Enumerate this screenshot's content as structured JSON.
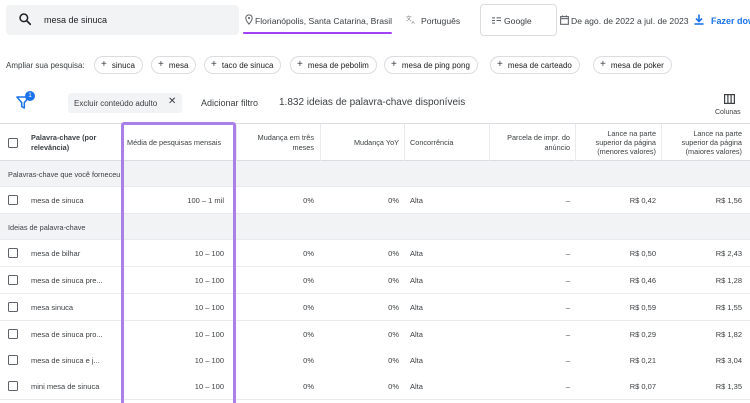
{
  "topbar": {
    "search_value": "mesa de sinuca",
    "location": "Florianópolis, Santa Catarina, Brasil",
    "language": "Português",
    "network": "Google",
    "date_range": "De ago. de 2022 a jul. de 2023",
    "download_label": "Fazer dow",
    "accent_color": "#a142f4",
    "link_color": "#1a73e8"
  },
  "broaden": {
    "label": "Ampliar sua pesquisa:",
    "chips": [
      "sinuca",
      "mesa",
      "taco de sinuca",
      "mesa de pebolim",
      "mesa de ping pong",
      "mesa de carteado",
      "mesa de poker"
    ]
  },
  "filters": {
    "badge": "1",
    "active_filter": "Excluir conteúdo adulto",
    "add_filter": "Adicionar filtro",
    "count_text": "1.832 ideias de palavra-chave disponíveis",
    "columns_label": "Colunas"
  },
  "table": {
    "headers": {
      "keyword": "Palavra-chave (por relevância)",
      "avg": "Média de pesquisas mensais",
      "three_month": "Mudança em três meses",
      "yoy": "Mudança YoY",
      "competition": "Concorrência",
      "impr_share": "Parcela de impr. do anúncio",
      "bid_low": "Lance na parte superior da página (menores valores)",
      "bid_high": "Lance na parte superior da página (maiores valores)"
    },
    "section_provided": "Palavras-chave que você forneceu",
    "section_ideas": "Ideias de palavra-chave",
    "provided_rows": [
      {
        "keyword": "mesa de sinuca",
        "avg": "100 – 1 mil",
        "three": "0%",
        "yoy": "0%",
        "comp": "Alta",
        "share": "–",
        "low": "R$ 0,42",
        "high": "R$ 1,56"
      }
    ],
    "idea_rows": [
      {
        "keyword": "mesa de bilhar",
        "avg": "10 – 100",
        "three": "0%",
        "yoy": "0%",
        "comp": "Alta",
        "share": "–",
        "low": "R$ 0,50",
        "high": "R$ 2,43"
      },
      {
        "keyword": "mesa de sinuca pre...",
        "avg": "10 – 100",
        "three": "0%",
        "yoy": "0%",
        "comp": "Alta",
        "share": "–",
        "low": "R$ 0,46",
        "high": "R$ 1,28"
      },
      {
        "keyword": "mesa sinuca",
        "avg": "10 – 100",
        "three": "0%",
        "yoy": "0%",
        "comp": "Alta",
        "share": "–",
        "low": "R$ 0,59",
        "high": "R$ 1,55"
      },
      {
        "keyword": "mesa de sinuca pro...",
        "avg": "10 – 100",
        "three": "0%",
        "yoy": "0%",
        "comp": "Alta",
        "share": "–",
        "low": "R$ 0,29",
        "high": "R$ 1,82"
      },
      {
        "keyword": "mesa de sinuca e j...",
        "avg": "10 – 100",
        "three": "0%",
        "yoy": "0%",
        "comp": "Alta",
        "share": "–",
        "low": "R$ 0,21",
        "high": "R$ 3,04"
      },
      {
        "keyword": "mini mesa de sinuca",
        "avg": "10 – 100",
        "three": "0%",
        "yoy": "0%",
        "comp": "Alta",
        "share": "–",
        "low": "R$ 0,07",
        "high": "R$ 1,35"
      }
    ]
  }
}
